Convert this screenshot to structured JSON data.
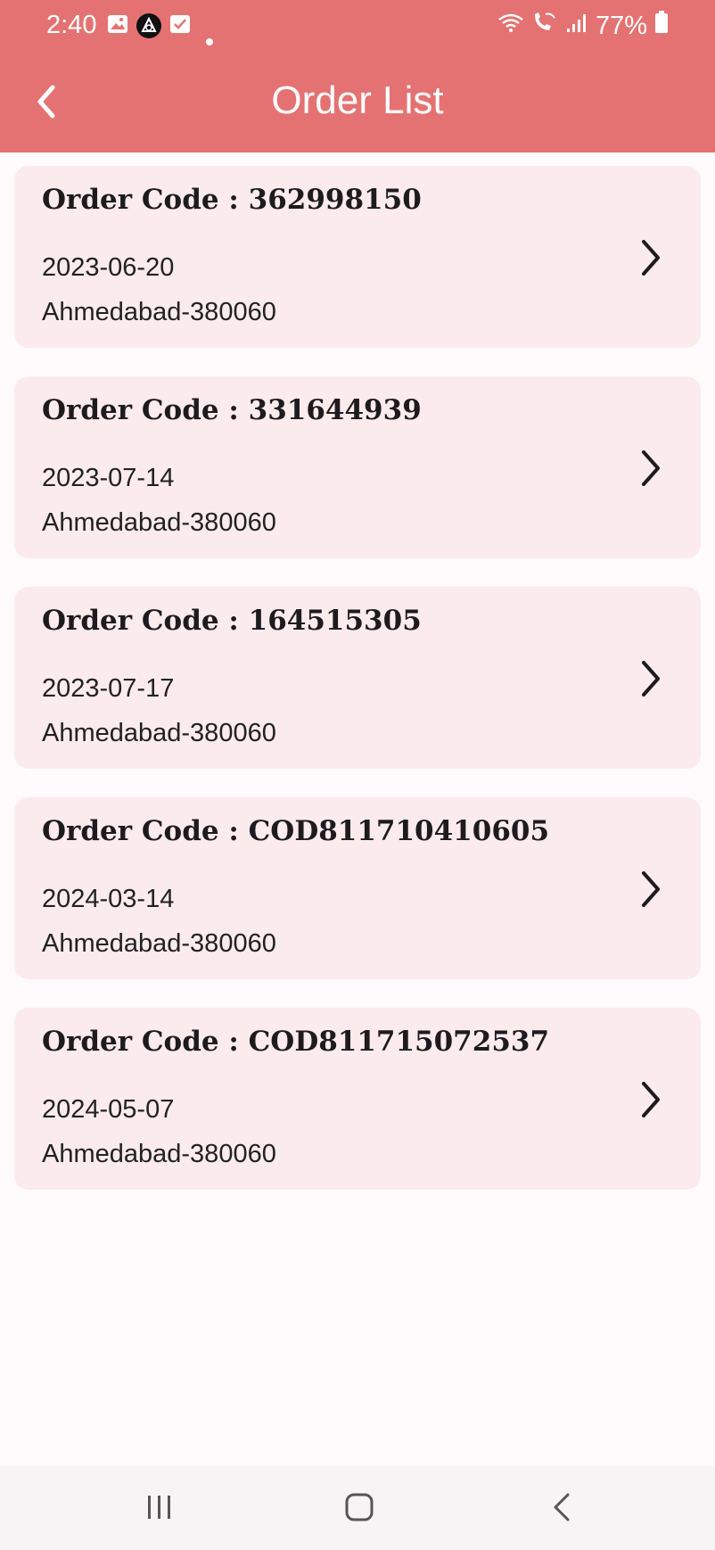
{
  "status_bar": {
    "time": "2:40",
    "battery": "77%",
    "icons": [
      "gallery-icon",
      "app-icon",
      "checkbox-icon",
      "dot-icon",
      "wifi-icon",
      "wifi-calling-icon",
      "signal-icon",
      "battery-icon"
    ]
  },
  "header": {
    "title": "Order List",
    "back_icon": "back-arrow-icon",
    "background": "#e57272"
  },
  "orders": [
    {
      "code": "Order Code : 362998150",
      "date": "2023-06-20",
      "address": "Ahmedabad-380060"
    },
    {
      "code": "Order Code : 331644939",
      "date": "2023-07-14",
      "address": "Ahmedabad-380060"
    },
    {
      "code": "Order Code : 164515305",
      "date": "2023-07-17",
      "address": "Ahmedabad-380060"
    },
    {
      "code": "Order Code : COD811710410605",
      "date": "2024-03-14",
      "address": "Ahmedabad-380060"
    },
    {
      "code": "Order Code : COD811715072537",
      "date": "2024-05-07",
      "address": "Ahmedabad-380060"
    }
  ],
  "colors": {
    "card_background": "#fcebec",
    "page_background": "#fffafb"
  },
  "navigation_bar": {
    "buttons": [
      "recent-apps-icon",
      "home-icon",
      "back-icon"
    ]
  }
}
